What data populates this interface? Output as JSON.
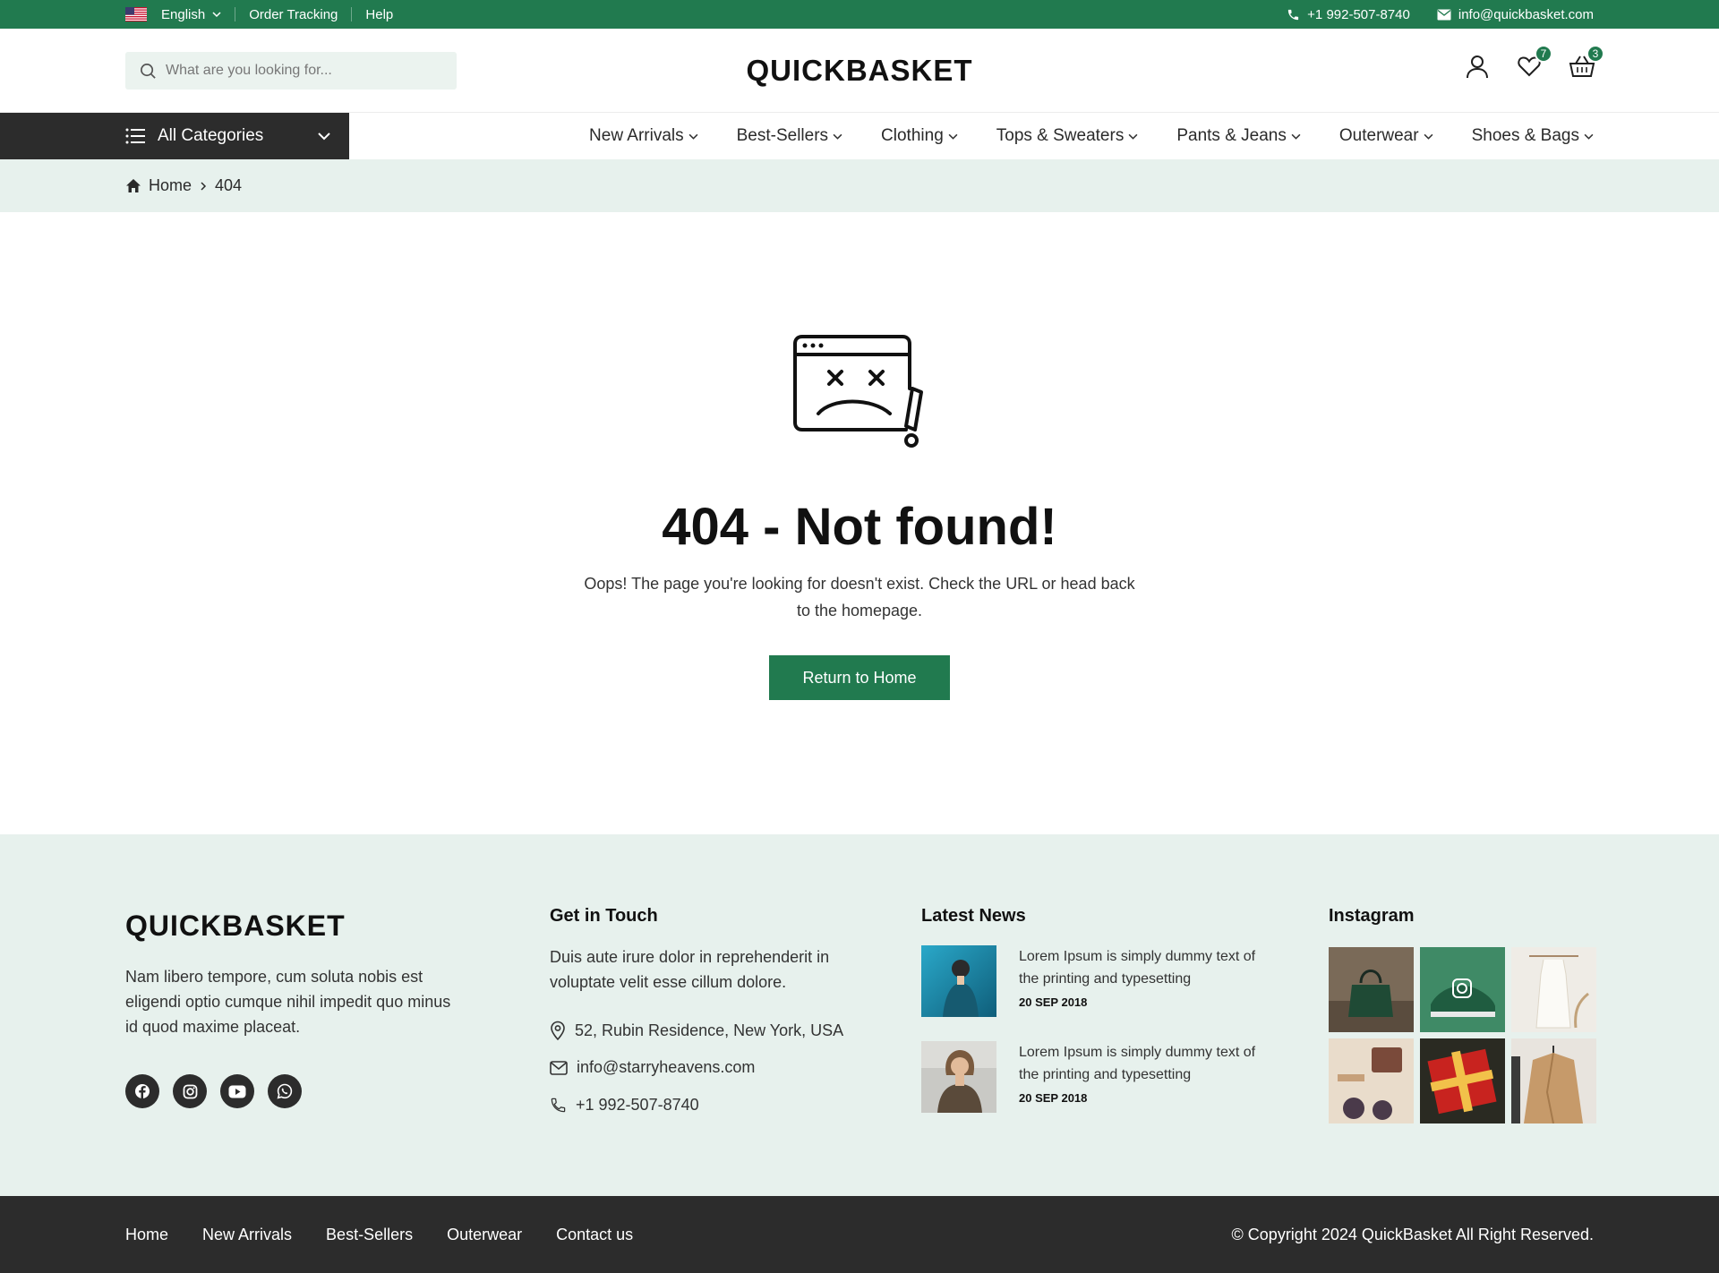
{
  "topbar": {
    "language": "English",
    "order_tracking": "Order Tracking",
    "help": "Help",
    "phone": "+1 992-507-8740",
    "email": "info@quickbasket.com"
  },
  "header": {
    "search_placeholder": "What are you looking for...",
    "logo": "QUICKBASKET",
    "wishlist_count": "7",
    "cart_count": "3"
  },
  "nav": {
    "categories_label": "All Categories",
    "items": [
      {
        "label": "New Arrivals"
      },
      {
        "label": "Best-Sellers"
      },
      {
        "label": "Clothing"
      },
      {
        "label": "Tops & Sweaters"
      },
      {
        "label": "Pants & Jeans"
      },
      {
        "label": "Outerwear"
      },
      {
        "label": "Shoes & Bags"
      }
    ]
  },
  "breadcrumb": {
    "home": "Home",
    "current": "404"
  },
  "error": {
    "title": "404 - Not found!",
    "message": "Oops! The page you're looking for doesn't exist. Check the URL or head back to the homepage.",
    "button": "Return to Home"
  },
  "footer": {
    "logo": "QUICKBASKET",
    "about": "Nam libero tempore, cum soluta nobis est eligendi optio cumque nihil impedit quo minus id quod maxime placeat.",
    "touch_heading": "Get in Touch",
    "touch_text": "Duis aute irure dolor in reprehenderit in voluptate velit esse cillum dolore.",
    "address": "52, Rubin Residence, New York, USA",
    "email": "info@starryheavens.com",
    "phone": "+1 992-507-8740",
    "news_heading": "Latest News",
    "news": [
      {
        "title": "Lorem Ipsum is simply dummy text of the printing and typesetting",
        "date": "20 SEP 2018"
      },
      {
        "title": "Lorem Ipsum is simply dummy text of the printing and typesetting",
        "date": "20 SEP 2018"
      }
    ],
    "instagram_heading": "Instagram"
  },
  "bottom": {
    "links": [
      "Home",
      "New Arrivals",
      "Best-Sellers",
      "Outerwear",
      "Contact us"
    ],
    "copyright": "© Copyright 2024 QuickBasket All Right Reserved."
  },
  "colors": {
    "brand_green": "#217a4f",
    "dark": "#2c2c2c",
    "mint_bg": "#e7f1ed"
  }
}
